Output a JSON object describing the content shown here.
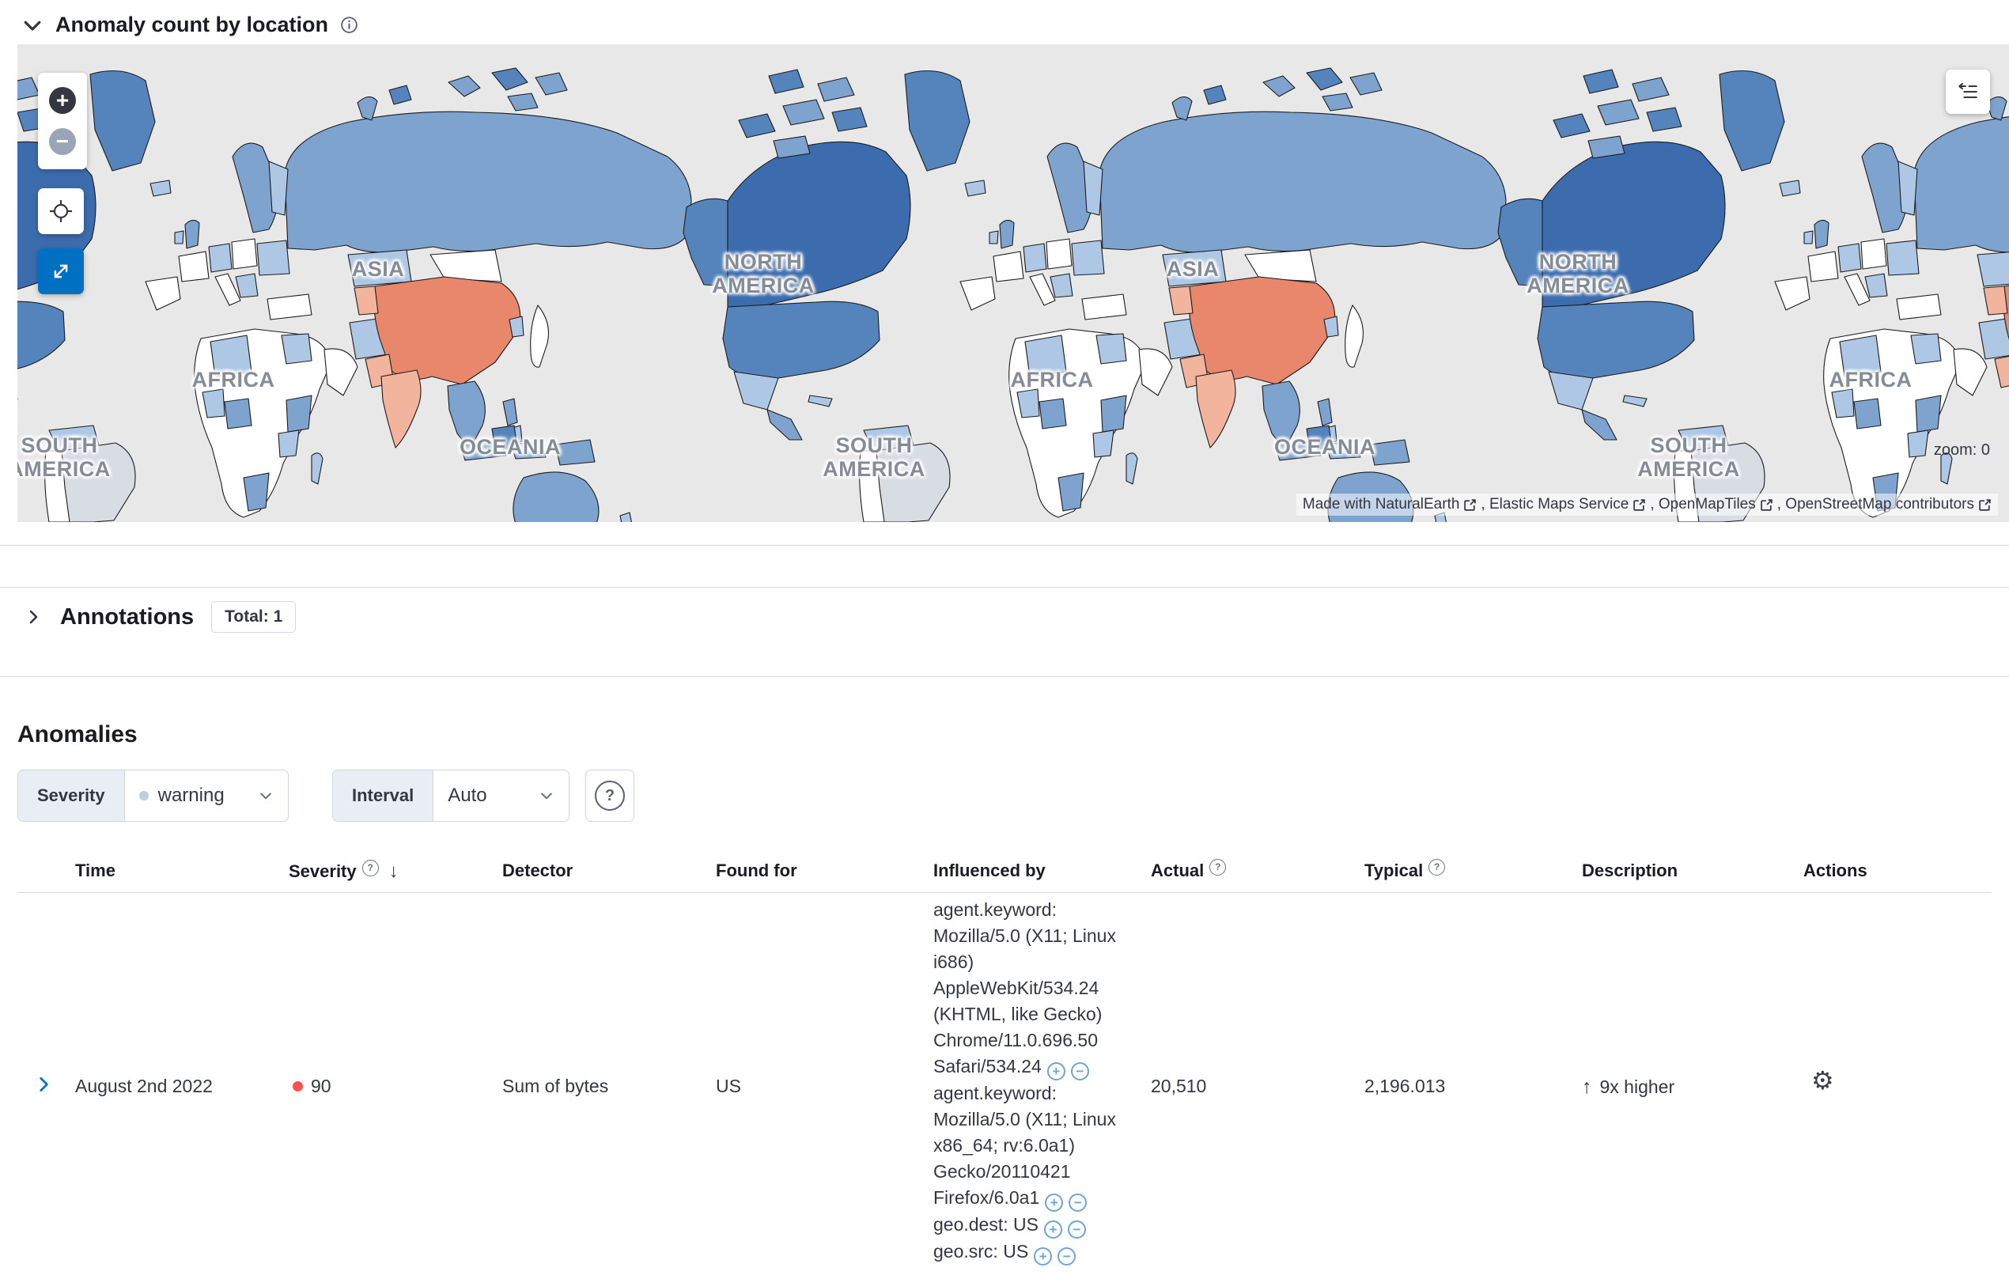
{
  "colors": {
    "accent_blue": "#0071c2",
    "critical_dot": "#fe5050",
    "warning_dot": "#c3cedb",
    "map_anomaly_high": "#e8876c",
    "map_dark_blue": "#3d6cae",
    "map_mid_blue": "#5584bd",
    "map_light_blue": "#7fa3cf",
    "map_no_data": "#d8dce3",
    "ocean": "#e8e8e8"
  },
  "icons": {
    "plus": "+",
    "minus": "−",
    "help": "?",
    "question_small": "?",
    "gear": "⚙",
    "up_arrow": "↑",
    "sort_desc": "↓"
  },
  "map_section": {
    "title": "Anomaly count by location",
    "zoom_label": "zoom: 0",
    "region_labels": [
      "ASIA",
      "NORTH AMERICA",
      "AFRICA",
      "SOUTH AMERICA",
      "OCEANIA"
    ],
    "attribution": [
      "Made with NaturalEarth",
      ", Elastic Maps Service",
      ", OpenMapTiles",
      ", OpenStreetMap contributors"
    ]
  },
  "annotations_section": {
    "title": "Annotations",
    "total_badge": "Total: 1"
  },
  "anomalies": {
    "title": "Anomalies",
    "severity_filter": {
      "label": "Severity",
      "value": "warning"
    },
    "interval_filter": {
      "label": "Interval",
      "value": "Auto"
    },
    "table": {
      "headers": {
        "time": "Time",
        "severity": "Severity",
        "detector": "Detector",
        "found_for": "Found for",
        "influenced_by": "Influenced by",
        "actual": "Actual",
        "typical": "Typical",
        "description": "Description",
        "actions": "Actions"
      },
      "row": {
        "time": "August 2nd 2022",
        "severity_score": "90",
        "detector": "Sum of bytes",
        "found_for": "US",
        "influenced_by": [
          "agent.keyword: Mozilla/5.0 (X11; Linux i686) AppleWebKit/534.24 (KHTML, like Gecko) Chrome/11.0.696.50 Safari/534.24",
          "agent.keyword: Mozilla/5.0 (X11; Linux x86_64; rv:6.0a1) Gecko/20110421 Firefox/6.0a1",
          "geo.dest: US",
          "geo.src: US"
        ],
        "actual": "20,510",
        "typical": "2,196.013",
        "description": "9x higher"
      }
    }
  }
}
